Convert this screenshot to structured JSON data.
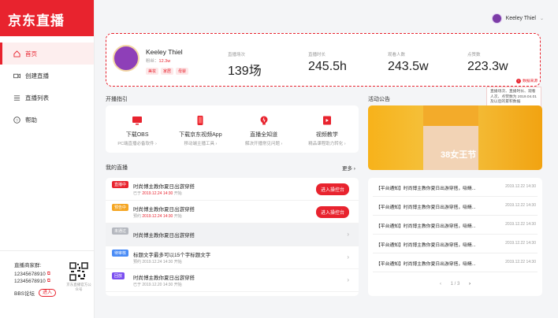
{
  "app": {
    "logo": "京东直播"
  },
  "nav": [
    {
      "label": "首页",
      "icon": "home-icon",
      "active": true
    },
    {
      "label": "创建直播",
      "icon": "video-icon",
      "active": false
    },
    {
      "label": "直播列表",
      "icon": "list-icon",
      "active": false
    },
    {
      "label": "帮助",
      "icon": "help-icon",
      "active": false
    }
  ],
  "contact": {
    "title": "直播商家群:",
    "phone1": "12345678910",
    "phone2": "12345678910",
    "bbs": "BBS论坛",
    "enter": "进入",
    "qr_caption": "京东直播官方公众号"
  },
  "user": {
    "name": "Keeley Thiel"
  },
  "profile": {
    "name": "Keeley Thiel",
    "fans_label": "粉丝：",
    "fans_value": "12.3w",
    "tags": [
      "美妆",
      "家居",
      "母婴"
    ]
  },
  "stats": [
    {
      "label": "直播场次",
      "value": "139场"
    },
    {
      "label": "直播时长",
      "value": "245.5h"
    },
    {
      "label": "观看人数",
      "value": "243.5w"
    },
    {
      "label": "点赞数",
      "value": "223.3w"
    }
  ],
  "tooltip": {
    "badge": "数据来源",
    "text": "直播场次、直播时长、观看人次、点赞数为 2019.04.01 及以后的累积数据"
  },
  "guide": {
    "title": "开播指引",
    "items": [
      {
        "title": "下载OBS",
        "sub": "PC端直播必备软件 ›",
        "icon": "monitor-icon"
      },
      {
        "title": "下载京东视频App",
        "sub": "移动端主播工具 ›",
        "icon": "phone-icon"
      },
      {
        "title": "直播全知道",
        "sub": "解决开播常见问题 ›",
        "icon": "bulb-icon"
      },
      {
        "title": "视频教学",
        "sub": "精品课程助力转化 ›",
        "icon": "video-lesson-icon"
      }
    ]
  },
  "announce": {
    "title": "活动公告",
    "banner_text": "38女王节",
    "items": [
      {
        "text": "【平台通知】时尚博主教你夏日出游穿搭，吸睛...",
        "date": "2019.12.22 14:30"
      },
      {
        "text": "【平台通知】时尚博主教你夏日出游穿搭，吸睛...",
        "date": "2019.12.22 14:30"
      },
      {
        "text": "【平台通知】时尚博主教你夏日出游穿搭，吸睛...",
        "date": "2019.12.22 14:30"
      },
      {
        "text": "【平台通知】时尚博主教你夏日出游穿搭，吸睛...",
        "date": "2019.12.22 14:30"
      },
      {
        "text": "【平台通知】时尚博主教你夏日出游穿搭，吸睛...",
        "date": "2019.12.22 14:30"
      }
    ],
    "pager": "1 / 3"
  },
  "mylive": {
    "title": "我的直播",
    "more": "更多 ›",
    "items": [
      {
        "status": "直播中",
        "color": "#e8232e",
        "title": "时尚博主教你夏日出游穿搭",
        "prefix": "已于",
        "time": "2019.12.24 14:30",
        "suffix": "开始",
        "time_red": true,
        "action": "进入操控台",
        "gray": false
      },
      {
        "status": "预告中",
        "color": "#f5a623",
        "title": "时尚博主教你夏日出游穿搭",
        "prefix": "预约",
        "time": "2019.12.24 14:30",
        "suffix": "开始",
        "time_red": true,
        "action": "进入操控台",
        "gray": false
      },
      {
        "status": "未通过",
        "color": "#b5b8bf",
        "title": "时尚博主教你夏日出游穿搭",
        "prefix": "",
        "time": "",
        "suffix": "",
        "time_red": false,
        "action": "",
        "gray": true
      },
      {
        "status": "待审核",
        "color": "#4a8cf6",
        "title": "标题文字最多可以15个字标题文字",
        "prefix": "预约",
        "time": "2019.12.24 14:30",
        "suffix": "开始",
        "time_red": false,
        "action": "",
        "gray": false
      },
      {
        "status": "回放",
        "color": "#7b4ff0",
        "title": "时尚博主教你夏日出游穿搭",
        "prefix": "已于",
        "time": "2019.12.20 14:30",
        "suffix": "开始",
        "time_red": false,
        "action": "",
        "gray": false
      }
    ]
  }
}
